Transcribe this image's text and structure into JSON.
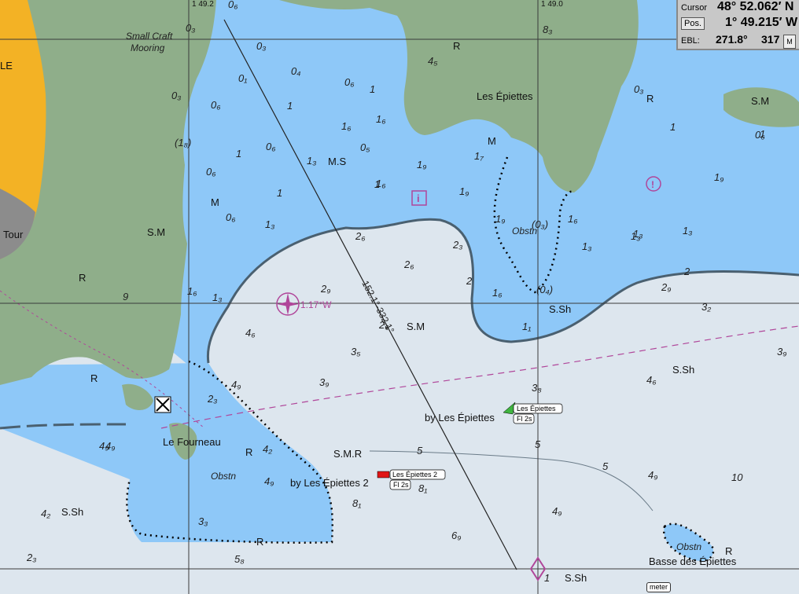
{
  "info_panel": {
    "cursor_label": "Cursor",
    "cursor_lat": "48° 52.062′ N",
    "pos_button": "Pos.",
    "cursor_lon": "1° 49.215′ W",
    "ebl_label": "EBL:",
    "ebl_bearing": "271.8°",
    "ebl_range": "317",
    "unit_button": "M"
  },
  "scale_label": "meter",
  "grid_labels": {
    "left": "1 49.2",
    "right": "1 49.0"
  },
  "place_names": {
    "les_epiettes": "Les Épiettes",
    "le_fourneau": "Le Fourneau",
    "basse_des_epiettes": "Basse des Épiettes",
    "tour": "Tour",
    "small_craft_mooring_1": "Small Craft",
    "small_craft_mooring_2": "Mooring",
    "edge_letters": "LE"
  },
  "buoys": {
    "green_name": "Les Épiettes",
    "green_light": "Fl 2s",
    "green_by": "by Les Épiettes",
    "red_name": "Les Épiettes 2",
    "red_light": "Fl 2s",
    "red_by": "by Les Épiettes 2"
  },
  "track": {
    "label": "152.1°-332.1°"
  },
  "variation": "1.17°W",
  "obstructions": {
    "obstn": "Obstn",
    "d03": "(0₃)",
    "d04": "(0₄)",
    "d18": "(1₈)"
  },
  "seabed": {
    "ms": "M.S",
    "sm": "S.M",
    "smr": "S.M.R",
    "ssh": "S.Sh",
    "r": "R",
    "m": "M"
  },
  "soundings": [
    "0₆",
    "0₃",
    "0₃",
    "0₄",
    "0₁",
    "0₆",
    "1",
    "0₃",
    "0₆",
    "1",
    "1₆",
    "1₆",
    "0₆",
    "1",
    "1₃",
    "1₉",
    "0₅",
    "1₉",
    "1₇",
    "1",
    "0₆",
    "0₆",
    "1",
    "1",
    "1₆",
    "1₃",
    "1₉",
    "1₃",
    "0₆",
    "1₃",
    "1₉",
    "1₃",
    "2₆",
    "2₆",
    "2₃",
    "2₉",
    "1₃",
    "1₆",
    "1₆",
    "1₁",
    "2₉",
    "3₂",
    "4₆",
    "3₅",
    "2₆",
    "3₉",
    "4₉",
    "4₆",
    "3₉",
    "3₈",
    "2₃",
    "4₂",
    "4₉",
    "4₉",
    "10",
    "8₁",
    "8₁",
    "6₉",
    "4₉",
    "4₉",
    "3₃",
    "4₂",
    "4₉",
    "2₃",
    "5₈",
    "1",
    "0₃",
    "1",
    "9",
    "8₃",
    "4₅",
    "1₆",
    "1₃"
  ],
  "contours": {
    "c2a": "2",
    "c2b": "2",
    "c5a": "5",
    "c5b": "5",
    "c5c": "5"
  },
  "colors": {
    "land": "#8fae8a",
    "shallow": "#8ec8f8",
    "deep": "#dde6ee",
    "drying": "#f3b225",
    "magenta": "#b0469a",
    "grid": "#3a3a3a"
  }
}
